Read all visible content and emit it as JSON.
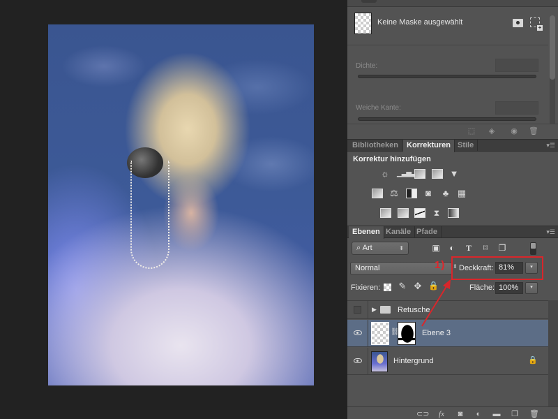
{
  "canvas": {
    "image_description": "Portrait of a blonde woman with a beaded eyepatch and pearl strands, wearing a white ruffled organza collar, against a mottled blue backdrop"
  },
  "properties_panel": {
    "mask_status": "Keine Maske ausgewählt",
    "density_label": "Dichte:",
    "feather_label": "Weiche Kante:",
    "density_value": "",
    "feather_value": "",
    "icons": [
      "pixel-mask-icon",
      "vector-mask-icon"
    ],
    "footer_icons": [
      "load-selection-icon",
      "apply-mask-icon",
      "visibility-icon",
      "trash-icon"
    ]
  },
  "adjustments_tabs": [
    {
      "label": "Bibliotheken",
      "active": false
    },
    {
      "label": "Korrekturen",
      "active": true
    },
    {
      "label": "Stile",
      "active": false
    }
  ],
  "adjustments": {
    "title": "Korrektur hinzufügen",
    "rows": [
      [
        "brightness-contrast-icon",
        "levels-icon",
        "curves-icon",
        "exposure-icon",
        "vibrance-icon"
      ],
      [
        "hue-saturation-icon",
        "color-balance-icon",
        "black-white-icon",
        "photo-filter-icon",
        "channel-mixer-icon",
        "color-lookup-icon"
      ],
      [
        "invert-icon",
        "posterize-icon",
        "threshold-icon",
        "selective-color-icon",
        "gradient-map-icon"
      ]
    ]
  },
  "layers_tabs": [
    {
      "label": "Ebenen",
      "active": true
    },
    {
      "label": "Kanäle",
      "active": false
    },
    {
      "label": "Pfade",
      "active": false
    }
  ],
  "layers": {
    "filter_kind": "Art",
    "blend_mode": "Normal",
    "opacity_label": "Deckkraft:",
    "opacity_value": "81%",
    "lock_label": "Fixieren:",
    "fill_label": "Fläche:",
    "fill_value": "100%",
    "items": [
      {
        "name": "Retusche",
        "type": "group",
        "visible": false,
        "selected": false,
        "locked": false
      },
      {
        "name": "Ebene 3",
        "type": "layer-with-mask",
        "visible": true,
        "selected": true,
        "locked": false
      },
      {
        "name": "Hintergrund",
        "type": "background",
        "visible": true,
        "selected": false,
        "locked": true
      }
    ],
    "footer_icons": [
      "link-layers-icon",
      "fx-icon",
      "add-mask-icon",
      "adjustment-layer-icon",
      "new-group-icon",
      "new-layer-icon",
      "delete-layer-icon"
    ]
  },
  "annotation": {
    "label": "1)",
    "color": "#d9262b",
    "target": "Deckkraft"
  },
  "colors": {
    "panel_bg": "#535353",
    "workspace_bg": "#222222",
    "selected_layer": "#5c6d86"
  }
}
